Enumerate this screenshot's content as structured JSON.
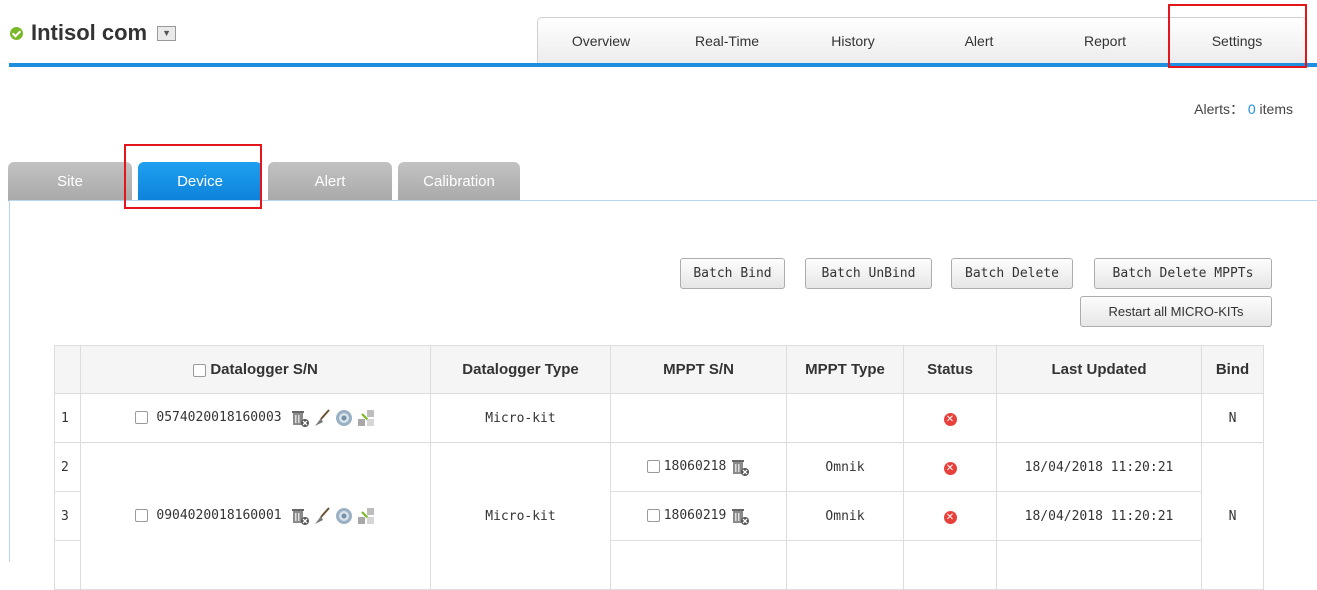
{
  "header": {
    "site_name": "Intisol com",
    "dropdown_glyph": "▼"
  },
  "nav": [
    {
      "label": "Overview"
    },
    {
      "label": "Real-Time"
    },
    {
      "label": "History"
    },
    {
      "label": "Alert"
    },
    {
      "label": "Report"
    },
    {
      "label": "Settings"
    }
  ],
  "alerts": {
    "label": "Alerts：",
    "count": "0",
    "suffix": "items"
  },
  "tabs": [
    {
      "label": "Site"
    },
    {
      "label": "Device",
      "active": true
    },
    {
      "label": "Alert"
    },
    {
      "label": "Calibration"
    }
  ],
  "buttons": {
    "batch_bind": "Batch Bind",
    "batch_unbind": "Batch UnBind",
    "batch_delete": "Batch Delete",
    "batch_delete_mppts": "Batch Delete MPPTs",
    "restart_all": "Restart all MICRO-KITs"
  },
  "table": {
    "columns": [
      "",
      "Datalogger S/N",
      "Datalogger Type",
      "MPPT S/N",
      "MPPT Type",
      "Status",
      "Last Updated",
      "Bind"
    ],
    "rows": [
      {
        "idx": "1",
        "sn": "0574020018160003",
        "type": "Micro-kit",
        "mppt_sn": "",
        "mppt_type": "",
        "status": "error",
        "updated": "",
        "bind": "N"
      },
      {
        "idx": "2",
        "mppt_sn": "18060218",
        "mppt_type": "Omnik",
        "status": "error",
        "updated": "18/04/2018 11:20:21"
      },
      {
        "idx": "3",
        "sn": "0904020018160001",
        "type": "Micro-kit",
        "mppt_sn": "18060219",
        "mppt_type": "Omnik",
        "status": "error",
        "updated": "18/04/2018 11:20:21",
        "bind": "N"
      }
    ]
  },
  "colors": {
    "accent": "#1e8fe0",
    "online": "#79b829",
    "error": "#e8413c",
    "highlight": "#e3161c"
  }
}
